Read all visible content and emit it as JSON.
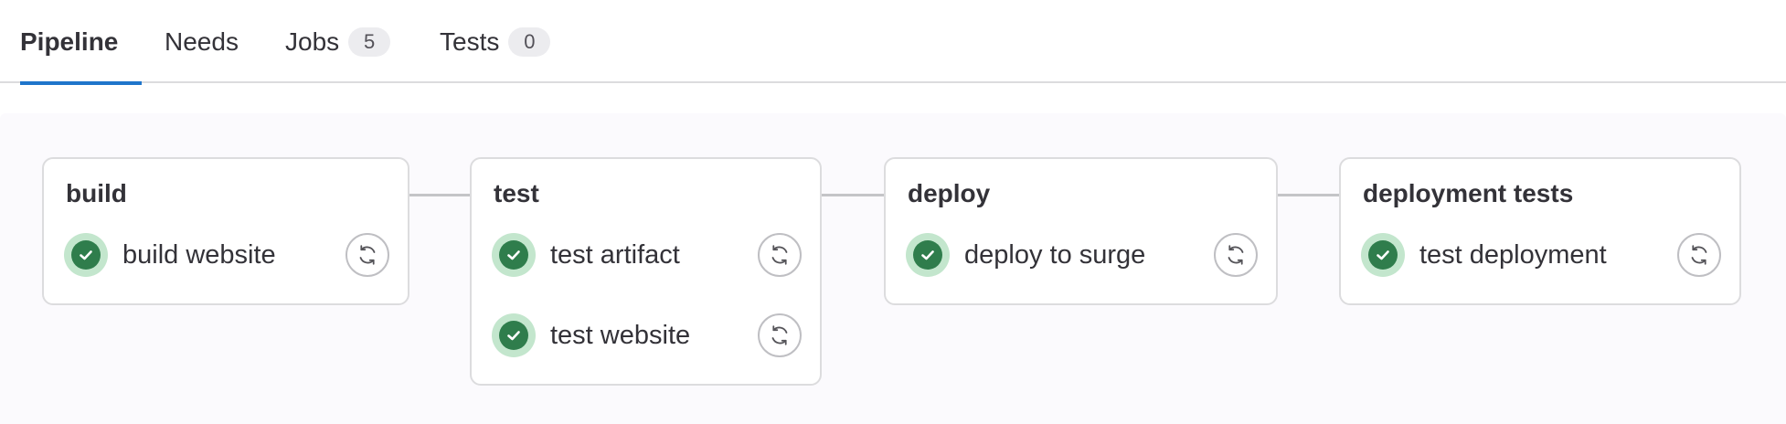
{
  "tabs": [
    {
      "label": "Pipeline",
      "active": true
    },
    {
      "label": "Needs"
    },
    {
      "label": "Jobs",
      "count": "5"
    },
    {
      "label": "Tests",
      "count": "0"
    }
  ],
  "colors": {
    "active_tab_underline": "#1f75cb",
    "success": "#2f7d4c",
    "success_bg": "#c3e6cd",
    "canvas_bg": "#fbfafd"
  },
  "stages": [
    {
      "title": "build",
      "jobs": [
        {
          "name": "build website",
          "status": "success",
          "action": "retry"
        }
      ]
    },
    {
      "title": "test",
      "jobs": [
        {
          "name": "test artifact",
          "status": "success",
          "action": "retry"
        },
        {
          "name": "test website",
          "status": "success",
          "action": "retry"
        }
      ]
    },
    {
      "title": "deploy",
      "jobs": [
        {
          "name": "deploy to surge",
          "status": "success",
          "action": "retry"
        }
      ]
    },
    {
      "title": "deployment tests",
      "jobs": [
        {
          "name": "test deployment",
          "status": "success",
          "action": "retry"
        }
      ]
    }
  ],
  "icons": {
    "status": "check-circle-icon",
    "action": "retry-icon"
  }
}
